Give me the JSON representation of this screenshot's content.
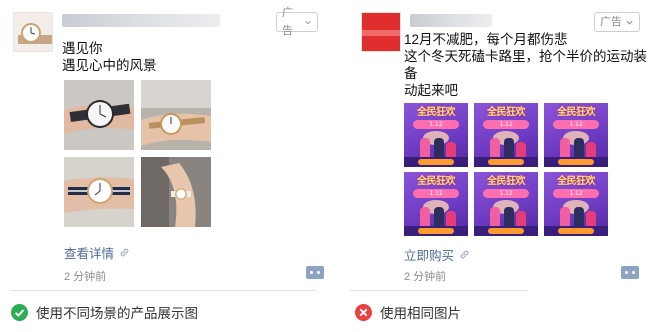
{
  "colors": {
    "link": "#4f6a95",
    "good": "#2eac57",
    "bad": "#e94242",
    "promo": "#7a45cf"
  },
  "left_card": {
    "ad_label": "广告",
    "post_lines": [
      "遇见你",
      "遇见心中的风景"
    ],
    "link_text": "查看详情",
    "time": "2 分钟前",
    "photos": [
      "watch-on-wrist-icon",
      "watch-on-wrist-icon",
      "watch-on-wrist-icon",
      "watch-on-wrist-icon"
    ]
  },
  "right_card": {
    "ad_label": "广告",
    "post_lines": [
      "12月不减肥，每个月都伤悲",
      "这个冬天死磕卡路里，抢个半价的运动装",
      "备",
      "动起来吧"
    ],
    "link_text": "立即购买",
    "time": "2 分钟前",
    "promo_title": "全民狂欢",
    "promo_sub": "1.12"
  },
  "verdicts": {
    "good": {
      "text": "使用不同场景的产品展示图",
      "icon": "check-circle-icon"
    },
    "bad": {
      "text": "使用相同图片",
      "icon": "cross-circle-icon"
    }
  }
}
